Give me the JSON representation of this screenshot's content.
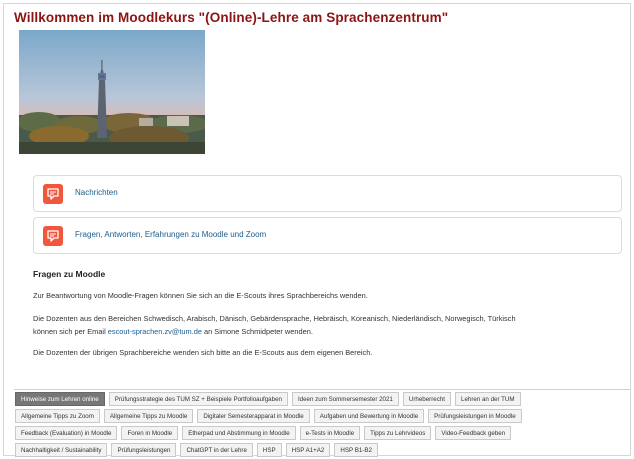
{
  "course": {
    "title": "Willkommen im Moodlekurs \"(Online)-Lehre am Sprachenzentrum\""
  },
  "activities": [
    {
      "label": "Nachrichten",
      "icon": "forum-icon"
    },
    {
      "label": "Fragen, Antworten, Erfahrungen zu Moodle und Zoom",
      "icon": "forum-icon"
    }
  ],
  "section": {
    "heading": "Fragen zu Moodle",
    "para1": "Zur Beantwortung von Moodle-Fragen können Sie sich an die E-Scouts ihres Sprachbereichs wenden.",
    "para2_line1": "Die Dozenten aus den Bereichen Schwedisch, Arabisch, Dänisch, Gebärdensprache, Hebräisch, Koreanisch, Niederländisch, Norwegisch, Türkisch",
    "para2_prefix": "können sich per Email ",
    "para2_email": "escout-sprachen.zv@tum.de",
    "para2_suffix": " an Simone Schmidpeter wenden.",
    "para3": "Die Dozenten der übrigen Sprachbereiche wenden sich bitte an die E-Scouts aus dem eigenen Bereich."
  },
  "tabs": {
    "row1": [
      "Hinweise zum Lehren online",
      "Prüfungsstrategie des TUM SZ + Beispiele Portfolioaufgaben",
      "Ideen zum Sommersemester 2021",
      "Urheberrecht",
      "Lehren an der TUM"
    ],
    "row2": [
      "Allgemeine Tipps zu Zoom",
      "Allgemeine Tipps zu Moodle",
      "Digitaler Semesterapparat in Moodle",
      "Aufgaben und Bewertung in Moodle",
      "Prüfungsleistungen in Moodle"
    ],
    "row3": [
      "Feedback (Evaluation) in Moodle",
      "Foren in Moodle",
      "Etherpad und Abstimmung in Moodle",
      "e-Tests in Moodle",
      "Tipps zu Lehrvideos",
      "Video-Feedback geben"
    ],
    "row4": [
      "Nachhaltigkeit / Sustainability",
      "Prüfungsleistungen",
      "ChatGPT in der Lehre",
      "HSP",
      "HSP A1+A2",
      "HSP B1-B2"
    ]
  },
  "colors": {
    "title": "#8b1414",
    "link": "#1a5d8f",
    "icon_bg": "#f0573d",
    "active_tab": "#777777"
  }
}
